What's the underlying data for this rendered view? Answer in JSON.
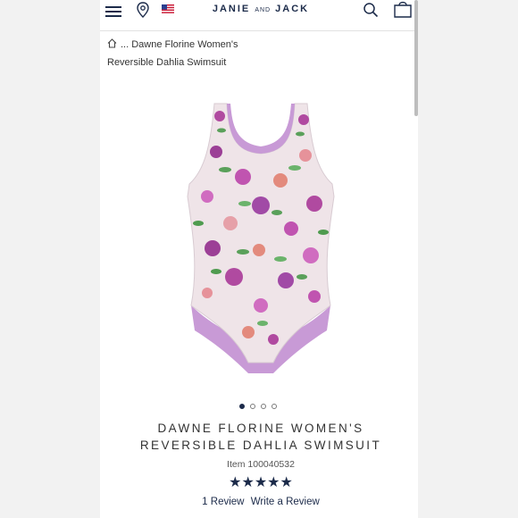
{
  "header": {
    "brand_main": "JANIE",
    "brand_and": "AND",
    "brand_end": "JACK",
    "icons": [
      "menu-icon",
      "location-pin-icon",
      "us-flag-icon",
      "search-icon",
      "shopping-bag-icon"
    ]
  },
  "breadcrumb": {
    "line1": "... Dawne Florine Women's",
    "line2": "Reversible Dahlia Swimsuit"
  },
  "product": {
    "title_line1": "DAWNE FLORINE WOMEN'S",
    "title_line2": "REVERSIBLE DAHLIA SWIMSUIT",
    "item_number": "Item 100040532",
    "rating_stars": "★★★★★",
    "rating_value": 5,
    "review_count": "1 Review",
    "write_review": "Write a Review"
  },
  "carousel": {
    "count": 4,
    "active": 1
  },
  "colors": {
    "navy": "#1c2b4a",
    "lining": "#c89ad6",
    "base_fabric": "#efe4e8"
  }
}
